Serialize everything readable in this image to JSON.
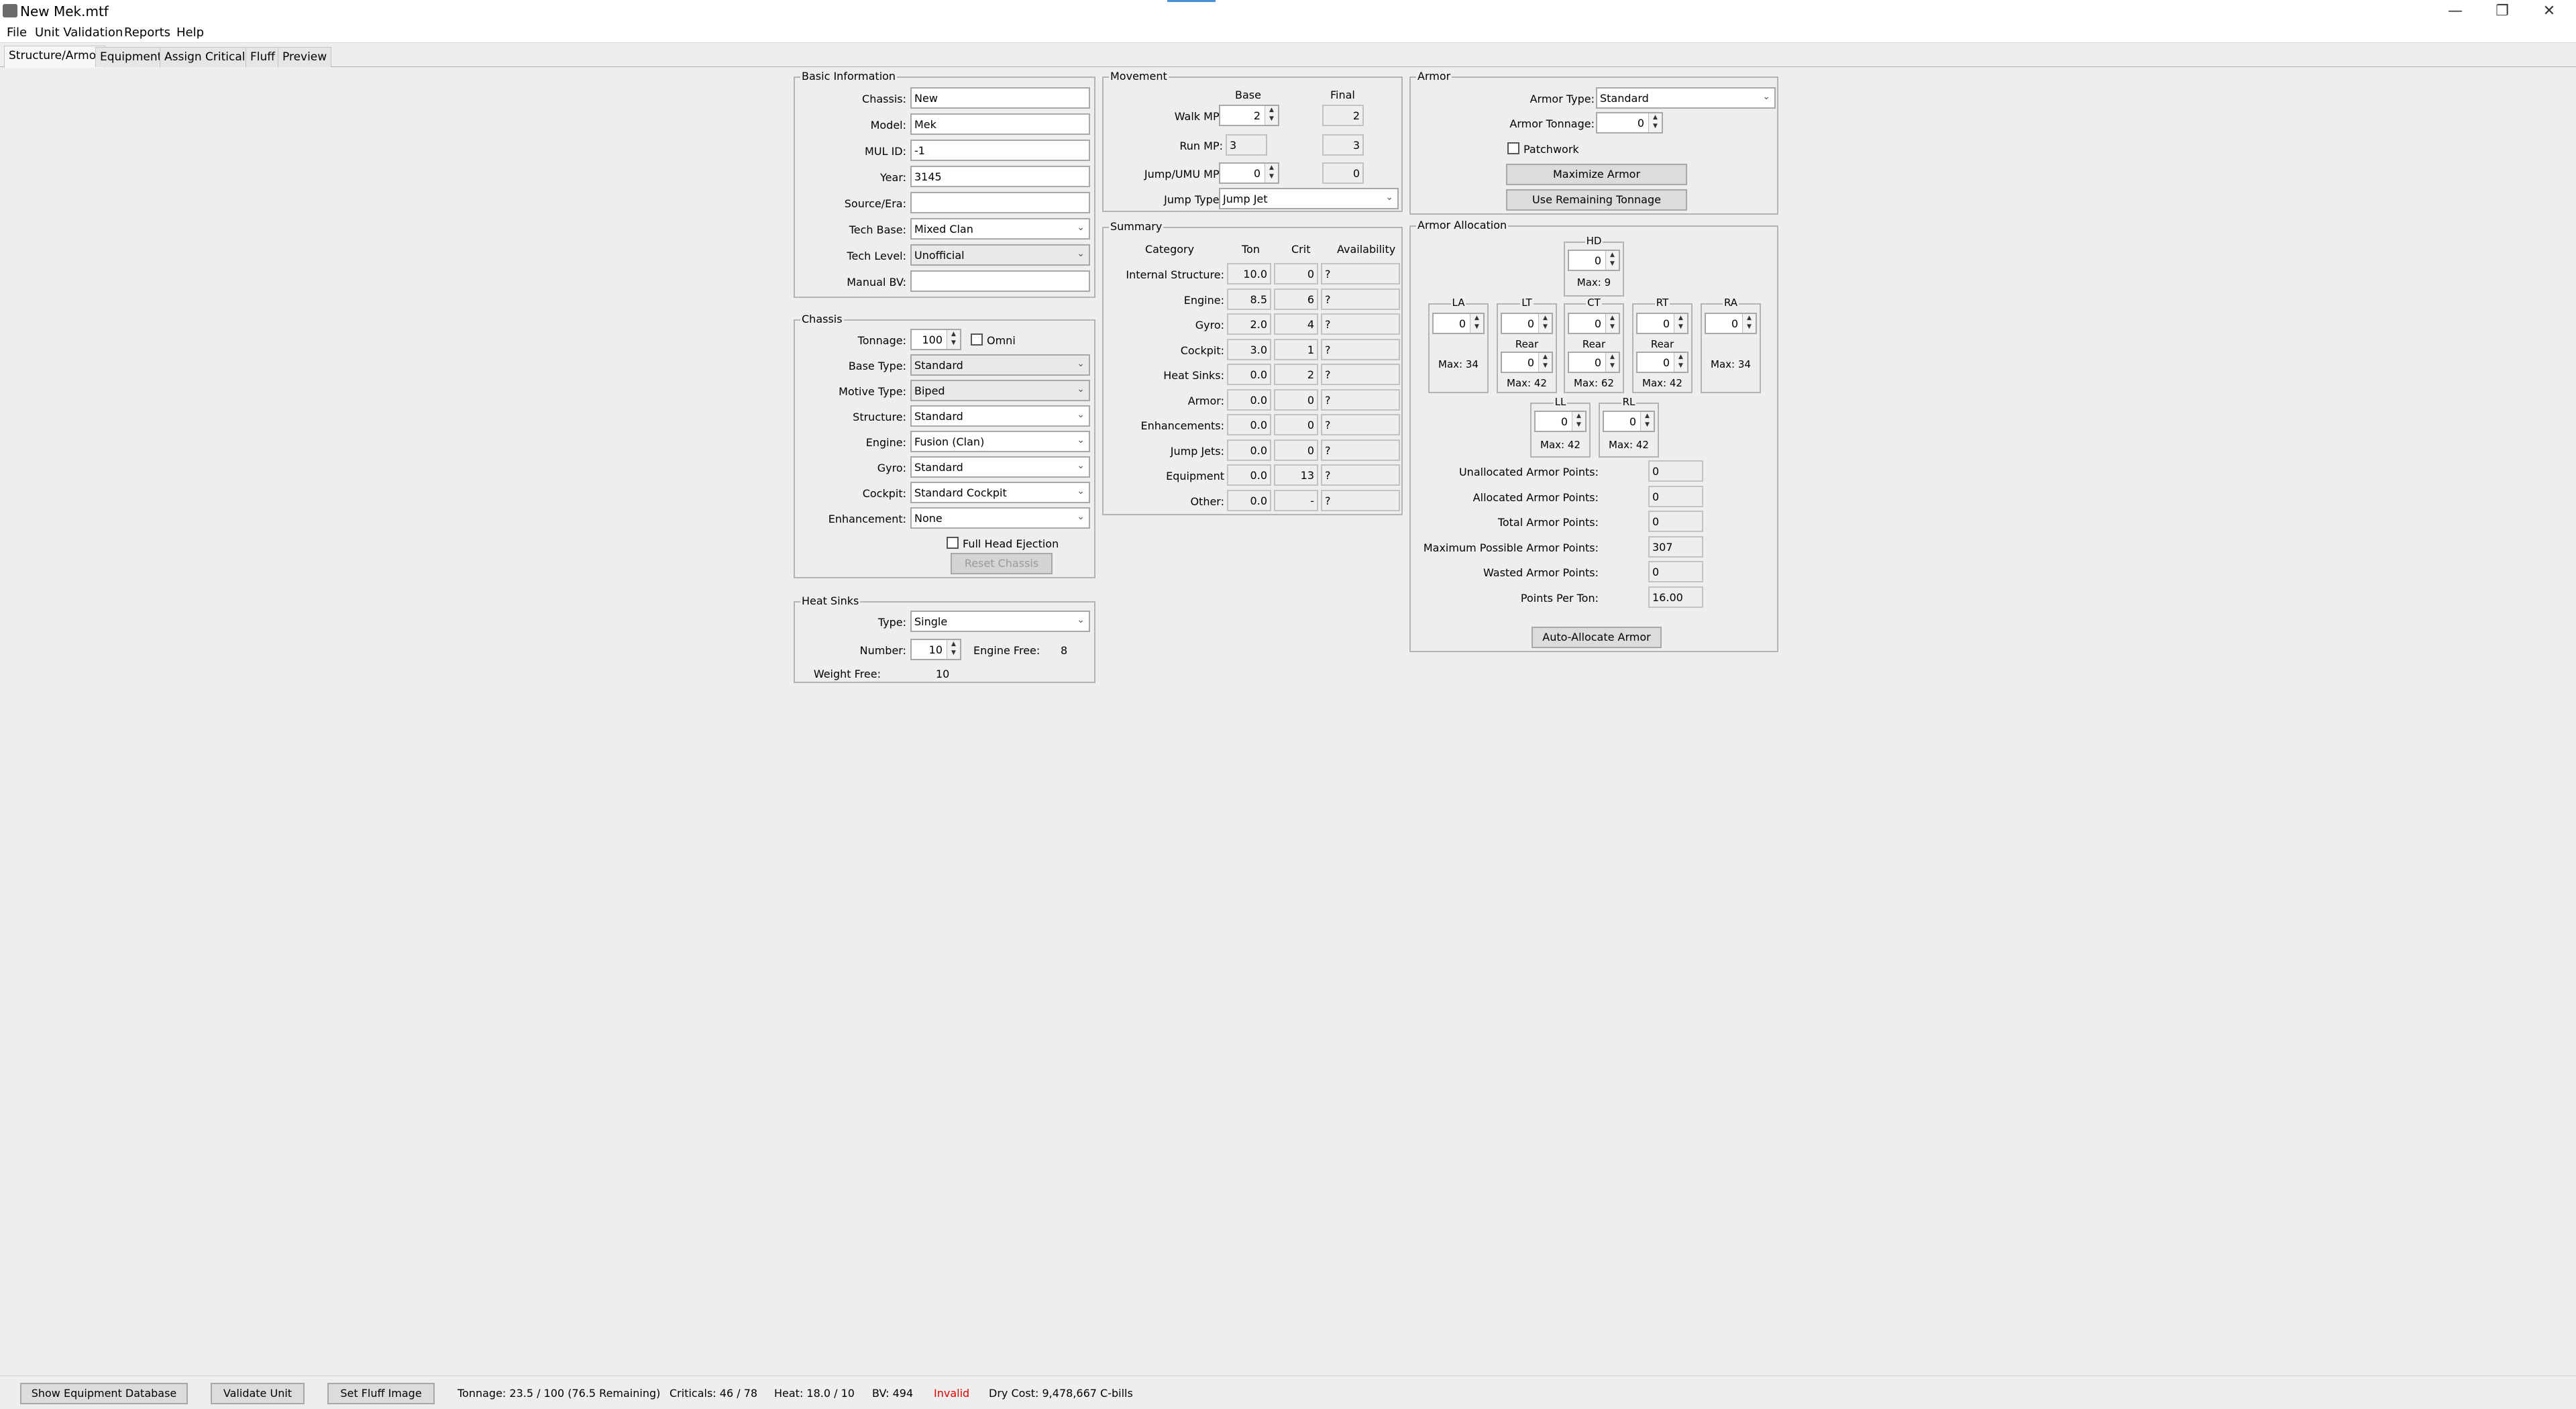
{
  "window": {
    "title": "New Mek.mtf",
    "icon": "mech-app-icon",
    "controls": [
      "minimize-icon",
      "restore-icon",
      "close-icon"
    ]
  },
  "menu": {
    "file": "File",
    "unit_validation": "Unit Validation",
    "reports": "Reports",
    "help": "Help"
  },
  "tabs": {
    "structure": "Structure/Armor",
    "equipment": "Equipment",
    "criticals": "Assign Criticals",
    "fluff": "Fluff",
    "preview": "Preview"
  },
  "basic": {
    "title": "Basic Information",
    "chassis_label": "Chassis:",
    "chassis": "New",
    "model_label": "Model:",
    "model": "Mek",
    "mul_label": "MUL ID:",
    "mul": "-1",
    "year_label": "Year:",
    "year": "3145",
    "source_label": "Source/Era:",
    "source": "",
    "techbase_label": "Tech Base:",
    "techbase": "Mixed Clan",
    "techlevel_label": "Tech Level:",
    "techlevel": "Unofficial",
    "bv_label": "Manual BV:",
    "bv": ""
  },
  "chassis": {
    "title": "Chassis",
    "tonnage_label": "Tonnage:",
    "tonnage": "100",
    "omni_label": "Omni",
    "basetype_label": "Base Type:",
    "basetype": "Standard",
    "motive_label": "Motive Type:",
    "motive": "Biped",
    "structure_label": "Structure:",
    "structure": "Standard",
    "engine_label": "Engine:",
    "engine": "Fusion (Clan)",
    "gyro_label": "Gyro:",
    "gyro": "Standard",
    "cockpit_label": "Cockpit:",
    "cockpit": "Standard Cockpit",
    "enh_label": "Enhancement:",
    "enh": "None",
    "ejection_label": "Full Head Ejection",
    "reset_label": "Reset Chassis"
  },
  "heatsinks": {
    "title": "Heat Sinks",
    "type_label": "Type:",
    "type": "Single",
    "number_label": "Number:",
    "number": "10",
    "engine_free_label": "Engine Free:",
    "engine_free": "8",
    "weight_free_label": "Weight Free:",
    "weight_free": "10"
  },
  "movement": {
    "title": "Movement",
    "base": "Base",
    "final": "Final",
    "walk_label": "Walk MP:",
    "walk": "2",
    "walk_final": "2",
    "run_label": "Run MP:",
    "run": "3",
    "run_final": "3",
    "jump_label": "Jump/UMU MP:",
    "jump": "0",
    "jump_final": "0",
    "jumptype_label": "Jump Type:",
    "jumptype": "Jump Jet"
  },
  "summary": {
    "title": "Summary",
    "headers": {
      "category": "Category",
      "ton": "Ton",
      "crit": "Crit",
      "avail": "Availability"
    },
    "rows": [
      {
        "label": "Internal Structure:",
        "ton": "10.0",
        "crit": "0",
        "avail": "?"
      },
      {
        "label": "Engine:",
        "ton": "8.5",
        "crit": "6",
        "avail": "?"
      },
      {
        "label": "Gyro:",
        "ton": "2.0",
        "crit": "4",
        "avail": "?"
      },
      {
        "label": "Cockpit:",
        "ton": "3.0",
        "crit": "1",
        "avail": "?"
      },
      {
        "label": "Heat Sinks:",
        "ton": "0.0",
        "crit": "2",
        "avail": "?"
      },
      {
        "label": "Armor:",
        "ton": "0.0",
        "crit": "0",
        "avail": "?"
      },
      {
        "label": "Enhancements:",
        "ton": "0.0",
        "crit": "0",
        "avail": "?"
      },
      {
        "label": "Jump Jets:",
        "ton": "0.0",
        "crit": "0",
        "avail": "?"
      },
      {
        "label": "Equipment",
        "ton": "0.0",
        "crit": "13",
        "avail": "?"
      },
      {
        "label": "Other:",
        "ton": "0.0",
        "crit": "-",
        "avail": "?"
      }
    ]
  },
  "armor": {
    "title": "Armor",
    "type_label": "Armor Type:",
    "type": "Standard",
    "tonnage_label": "Armor Tonnage:",
    "tonnage": "0",
    "patchwork_label": "Patchwork",
    "maximize_label": "Maximize Armor",
    "remaining_label": "Use Remaining Tonnage"
  },
  "allocation": {
    "title": "Armor Allocation",
    "rear_label": "Rear",
    "hd": {
      "label": "HD",
      "value": "0",
      "max": "Max: 9"
    },
    "la": {
      "label": "LA",
      "value": "0",
      "max": "Max: 34"
    },
    "lt": {
      "label": "LT",
      "value": "0",
      "rear": "0",
      "max": "Max: 42"
    },
    "ct": {
      "label": "CT",
      "value": "0",
      "rear": "0",
      "max": "Max: 62"
    },
    "rt": {
      "label": "RT",
      "value": "0",
      "rear": "0",
      "max": "Max: 42"
    },
    "ra": {
      "label": "RA",
      "value": "0",
      "max": "Max: 34"
    },
    "ll": {
      "label": "LL",
      "value": "0",
      "max": "Max: 42"
    },
    "rl": {
      "label": "RL",
      "value": "0",
      "max": "Max: 42"
    },
    "stats": [
      {
        "label": "Unallocated Armor Points:",
        "value": "0"
      },
      {
        "label": "Allocated Armor Points:",
        "value": "0"
      },
      {
        "label": "Total Armor Points:",
        "value": "0"
      },
      {
        "label": "Maximum Possible Armor Points:",
        "value": "307"
      },
      {
        "label": "Wasted Armor Points:",
        "value": "0"
      },
      {
        "label": "Points Per Ton:",
        "value": "16.00"
      }
    ],
    "auto_label": "Auto-Allocate Armor"
  },
  "status": {
    "show_db": "Show Equipment Database",
    "validate": "Validate Unit",
    "fluff_image": "Set Fluff Image",
    "tonnage": "Tonnage: 23.5 / 100 (76.5 Remaining)",
    "criticals": "Criticals: 46 / 78",
    "heat": "Heat: 18.0 / 10",
    "bv": "BV: 494",
    "invalid": "Invalid",
    "cost": "Dry Cost: 9,478,667 C-bills",
    "invalid_color": "#e00000"
  }
}
